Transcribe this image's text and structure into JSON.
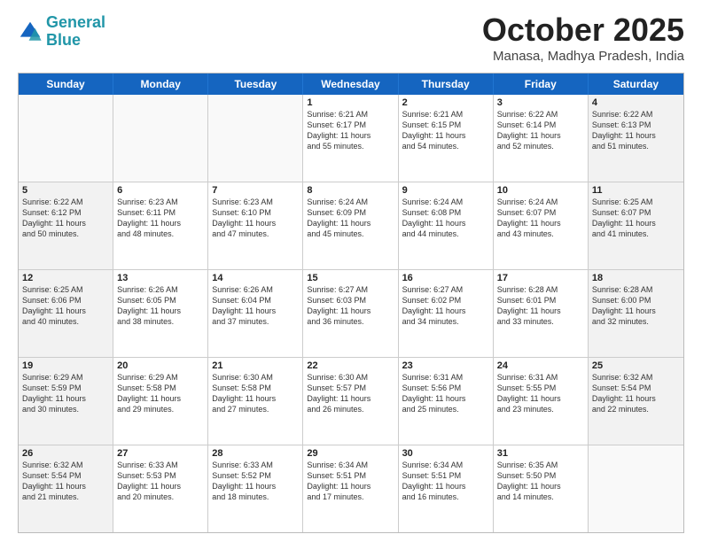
{
  "header": {
    "logo_line1": "General",
    "logo_line2": "Blue",
    "month": "October 2025",
    "location": "Manasa, Madhya Pradesh, India"
  },
  "weekdays": [
    "Sunday",
    "Monday",
    "Tuesday",
    "Wednesday",
    "Thursday",
    "Friday",
    "Saturday"
  ],
  "rows": [
    [
      {
        "day": "",
        "detail": ""
      },
      {
        "day": "",
        "detail": ""
      },
      {
        "day": "",
        "detail": ""
      },
      {
        "day": "1",
        "detail": "Sunrise: 6:21 AM\nSunset: 6:17 PM\nDaylight: 11 hours\nand 55 minutes."
      },
      {
        "day": "2",
        "detail": "Sunrise: 6:21 AM\nSunset: 6:15 PM\nDaylight: 11 hours\nand 54 minutes."
      },
      {
        "day": "3",
        "detail": "Sunrise: 6:22 AM\nSunset: 6:14 PM\nDaylight: 11 hours\nand 52 minutes."
      },
      {
        "day": "4",
        "detail": "Sunrise: 6:22 AM\nSunset: 6:13 PM\nDaylight: 11 hours\nand 51 minutes."
      }
    ],
    [
      {
        "day": "5",
        "detail": "Sunrise: 6:22 AM\nSunset: 6:12 PM\nDaylight: 11 hours\nand 50 minutes."
      },
      {
        "day": "6",
        "detail": "Sunrise: 6:23 AM\nSunset: 6:11 PM\nDaylight: 11 hours\nand 48 minutes."
      },
      {
        "day": "7",
        "detail": "Sunrise: 6:23 AM\nSunset: 6:10 PM\nDaylight: 11 hours\nand 47 minutes."
      },
      {
        "day": "8",
        "detail": "Sunrise: 6:24 AM\nSunset: 6:09 PM\nDaylight: 11 hours\nand 45 minutes."
      },
      {
        "day": "9",
        "detail": "Sunrise: 6:24 AM\nSunset: 6:08 PM\nDaylight: 11 hours\nand 44 minutes."
      },
      {
        "day": "10",
        "detail": "Sunrise: 6:24 AM\nSunset: 6:07 PM\nDaylight: 11 hours\nand 43 minutes."
      },
      {
        "day": "11",
        "detail": "Sunrise: 6:25 AM\nSunset: 6:07 PM\nDaylight: 11 hours\nand 41 minutes."
      }
    ],
    [
      {
        "day": "12",
        "detail": "Sunrise: 6:25 AM\nSunset: 6:06 PM\nDaylight: 11 hours\nand 40 minutes."
      },
      {
        "day": "13",
        "detail": "Sunrise: 6:26 AM\nSunset: 6:05 PM\nDaylight: 11 hours\nand 38 minutes."
      },
      {
        "day": "14",
        "detail": "Sunrise: 6:26 AM\nSunset: 6:04 PM\nDaylight: 11 hours\nand 37 minutes."
      },
      {
        "day": "15",
        "detail": "Sunrise: 6:27 AM\nSunset: 6:03 PM\nDaylight: 11 hours\nand 36 minutes."
      },
      {
        "day": "16",
        "detail": "Sunrise: 6:27 AM\nSunset: 6:02 PM\nDaylight: 11 hours\nand 34 minutes."
      },
      {
        "day": "17",
        "detail": "Sunrise: 6:28 AM\nSunset: 6:01 PM\nDaylight: 11 hours\nand 33 minutes."
      },
      {
        "day": "18",
        "detail": "Sunrise: 6:28 AM\nSunset: 6:00 PM\nDaylight: 11 hours\nand 32 minutes."
      }
    ],
    [
      {
        "day": "19",
        "detail": "Sunrise: 6:29 AM\nSunset: 5:59 PM\nDaylight: 11 hours\nand 30 minutes."
      },
      {
        "day": "20",
        "detail": "Sunrise: 6:29 AM\nSunset: 5:58 PM\nDaylight: 11 hours\nand 29 minutes."
      },
      {
        "day": "21",
        "detail": "Sunrise: 6:30 AM\nSunset: 5:58 PM\nDaylight: 11 hours\nand 27 minutes."
      },
      {
        "day": "22",
        "detail": "Sunrise: 6:30 AM\nSunset: 5:57 PM\nDaylight: 11 hours\nand 26 minutes."
      },
      {
        "day": "23",
        "detail": "Sunrise: 6:31 AM\nSunset: 5:56 PM\nDaylight: 11 hours\nand 25 minutes."
      },
      {
        "day": "24",
        "detail": "Sunrise: 6:31 AM\nSunset: 5:55 PM\nDaylight: 11 hours\nand 23 minutes."
      },
      {
        "day": "25",
        "detail": "Sunrise: 6:32 AM\nSunset: 5:54 PM\nDaylight: 11 hours\nand 22 minutes."
      }
    ],
    [
      {
        "day": "26",
        "detail": "Sunrise: 6:32 AM\nSunset: 5:54 PM\nDaylight: 11 hours\nand 21 minutes."
      },
      {
        "day": "27",
        "detail": "Sunrise: 6:33 AM\nSunset: 5:53 PM\nDaylight: 11 hours\nand 20 minutes."
      },
      {
        "day": "28",
        "detail": "Sunrise: 6:33 AM\nSunset: 5:52 PM\nDaylight: 11 hours\nand 18 minutes."
      },
      {
        "day": "29",
        "detail": "Sunrise: 6:34 AM\nSunset: 5:51 PM\nDaylight: 11 hours\nand 17 minutes."
      },
      {
        "day": "30",
        "detail": "Sunrise: 6:34 AM\nSunset: 5:51 PM\nDaylight: 11 hours\nand 16 minutes."
      },
      {
        "day": "31",
        "detail": "Sunrise: 6:35 AM\nSunset: 5:50 PM\nDaylight: 11 hours\nand 14 minutes."
      },
      {
        "day": "",
        "detail": ""
      }
    ]
  ]
}
